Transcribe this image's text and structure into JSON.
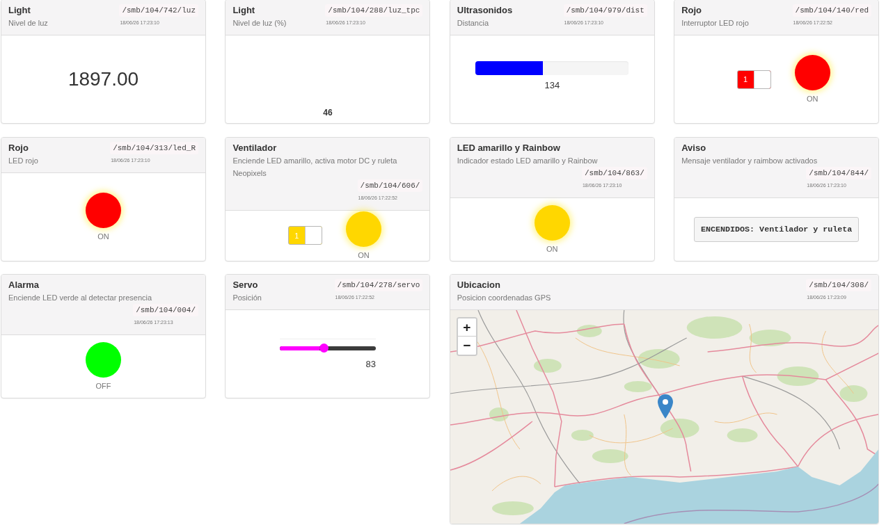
{
  "widgets": [
    {
      "kind": "value",
      "title": "Light",
      "description": "Nivel de luz",
      "topic": "/smb/104/742/luz",
      "timestamp": "18/06/26 17:23:10",
      "value": "1897.00"
    },
    {
      "kind": "value_bottom",
      "title": "Light",
      "description": "Nivel de luz (%)",
      "topic": "/smb/104/288/luz_tpc",
      "timestamp": "18/06/26 17:23:10",
      "value": "46"
    },
    {
      "kind": "progress",
      "title": "Ultrasonidos",
      "description": "Distancia",
      "topic": "/smb/104/979/dist",
      "timestamp": "18/06/26 17:23:10",
      "level": 0.44,
      "value": "134"
    },
    {
      "kind": "switch_led",
      "title": "Rojo",
      "description": "Interruptor LED rojo",
      "topic": "/smb/104/140/red",
      "timestamp": "18/06/26 17:22:52",
      "switch": {
        "label": "1",
        "on": true
      },
      "led": {
        "on": true,
        "color": "#ff0000",
        "label": "ON"
      }
    },
    {
      "kind": "led",
      "title": "Rojo",
      "description": "LED rojo",
      "topic": "/smb/104/313/led_R",
      "timestamp": "18/06/26 17:23:10",
      "led": {
        "on": true,
        "color": "#ff0000",
        "label": "ON"
      }
    },
    {
      "kind": "switch_led",
      "title": "Ventilador",
      "description": "Enciende LED amarillo, activa motor DC y ruleta Neopixels",
      "topic": "/smb/104/606/",
      "timestamp": "18/06/26 17:22:52",
      "switch": {
        "label": "1",
        "on": true
      },
      "led": {
        "on": true,
        "color": "#ffd700",
        "label": "ON"
      }
    },
    {
      "kind": "led",
      "title": "LED amarillo y Rainbow",
      "description": "Indicador estado LED amarillo y Rainbow",
      "topic": "/smb/104/863/",
      "timestamp": "18/06/26 17:23:10",
      "led": {
        "on": true,
        "color": "#ffd700",
        "label": "ON"
      }
    },
    {
      "kind": "message",
      "title": "Aviso",
      "description": "Mensaje ventilador y raimbow activados",
      "topic": "/smb/104/844/",
      "timestamp": "18/06/26 17:23:10",
      "message": "ENCENDIDOS: Ventilador y ruleta"
    },
    {
      "kind": "led",
      "title": "Alarma",
      "description": "Enciende LED verde al detectar presencia",
      "topic": "/smb/104/004/",
      "timestamp": "18/06/26 17:23:13",
      "led": {
        "on": false,
        "color": "#00ff00",
        "label": "OFF"
      }
    },
    {
      "kind": "slider",
      "title": "Servo",
      "description": "Posición",
      "topic": "/smb/104/278/servo",
      "timestamp": "18/06/26 17:22:52",
      "level": 0.46,
      "value": "83"
    },
    {
      "kind": "map",
      "title": "Ubicacion",
      "description": "Posicion coordenadas GPS",
      "topic": "/smb/104/308/",
      "timestamp": "18/06/26 17:23:09",
      "zoom_controls": [
        "+",
        "−"
      ]
    }
  ]
}
